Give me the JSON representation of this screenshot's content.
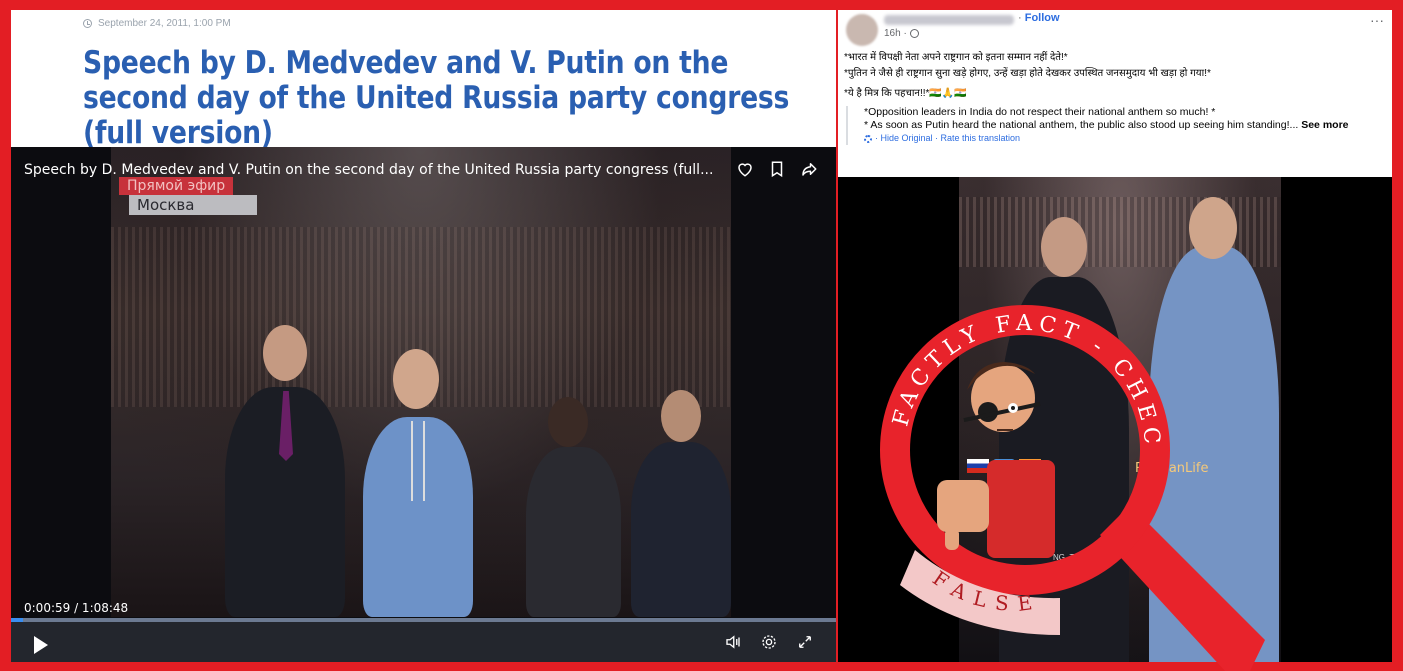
{
  "article": {
    "date": "September 24, 2011, 1:00 PM",
    "headline": "Speech by D. Medvedev and V. Putin on the second day of the United Russia party congress (full version)"
  },
  "video": {
    "title": "Speech by D. Medvedev and V. Putin on the second day of the United Russia party congress (full...",
    "live_badge": "Прямой эфир",
    "city_badge": "Москва",
    "timecode": "0:00:59 / 1:08:48",
    "progress_fraction": 0.014,
    "top_icons": [
      "heart-icon",
      "bookmark-icon",
      "share-icon"
    ],
    "control_icons": [
      "play-icon",
      "volume-icon",
      "settings-icon",
      "fullscreen-icon"
    ]
  },
  "post": {
    "follow_label": "Follow",
    "time": "16h ·",
    "hindi_lines": [
      "*भारत में विपक्षी नेता अपने राष्ट्रगान को इतना सम्मान नहीं देते!*",
      "*पुतिन ने जैसे ही राष्ट्रगान सुना खड़े होगए, उन्हें खड़ा होते देखकर उपस्थित जनसमुदाय भी खड़ा हो गया!*",
      "*ये है मित्र कि पहचान!!*🇮🇳🙏🇮🇳"
    ],
    "translation_lines": [
      "*Opposition leaders in India do not respect their national anthem so much! *",
      "* As soon as Putin heard the national anthem, the public also stood up seeing him standing!..."
    ],
    "see_more": "See more",
    "translation_links": "· Hide Original · Rate this translation",
    "video_watermark": "RussianLife",
    "video_watermark_small": "NG_THA"
  },
  "stamp": {
    "top_text": "FACTLY FACT - CHECK",
    "verdict": "FALSE"
  },
  "colors": {
    "background": "#e31e24",
    "headline": "#2a5fb1",
    "link": "#2d6de0",
    "stamp_red": "#e8232b"
  }
}
